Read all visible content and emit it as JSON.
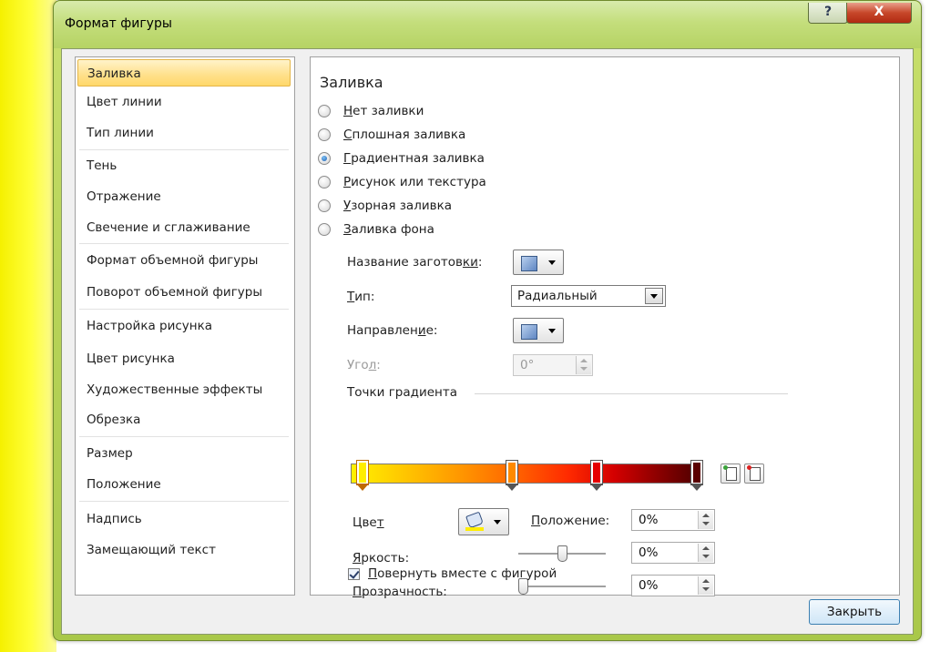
{
  "window": {
    "title": "Формат фигуры",
    "help_symbol": "?",
    "close_symbol": "X"
  },
  "nav": {
    "items": [
      {
        "label": "Заливка",
        "selected": true
      },
      {
        "label": "Цвет линии"
      },
      {
        "label": "Тип линии"
      },
      {
        "label": "Тень"
      },
      {
        "label": "Отражение"
      },
      {
        "label": "Свечение и сглаживание"
      },
      {
        "label": "Формат объемной фигуры"
      },
      {
        "label": "Поворот объемной фигуры"
      },
      {
        "label": "Настройка рисунка"
      },
      {
        "label": "Цвет рисунка"
      },
      {
        "label": "Художественные эффекты"
      },
      {
        "label": "Обрезка"
      },
      {
        "label": "Размер"
      },
      {
        "label": "Положение"
      },
      {
        "label": "Надпись"
      },
      {
        "label": "Замещающий текст"
      }
    ]
  },
  "fill": {
    "heading": "Заливка",
    "options": [
      {
        "hot": "Н",
        "rest": "ет заливки",
        "checked": false
      },
      {
        "hot": "С",
        "rest": "плошная заливка",
        "checked": false
      },
      {
        "hot": "Г",
        "rest": "радиентная заливка",
        "checked": true
      },
      {
        "hot": "Р",
        "rest": "исунок или текстура",
        "checked": false
      },
      {
        "hot": "У",
        "rest": "зорная заливка",
        "checked": false
      },
      {
        "hot": "З",
        "rest": "аливка фона",
        "checked": false
      }
    ],
    "preset_label_a": "Название заготов",
    "preset_label_hot": "ки",
    "preset_label_b": ":",
    "type_label_hot": "Т",
    "type_label_rest": "ип:",
    "type_value": "Радиальный",
    "direction_label_a": "Направлен",
    "direction_label_hot": "и",
    "direction_label_b": "е:",
    "angle_label_a": "Уго",
    "angle_label_hot": "л",
    "angle_label_b": ":",
    "angle_value": "0°",
    "stops_heading": "Точки градиента",
    "color_label_a": "Цве",
    "color_label_hot": "т",
    "position_label_hot": "П",
    "position_label_rest": "оложение:",
    "position_value": "0%",
    "brightness_label_hot": "Я",
    "brightness_label_rest": "ркость:",
    "brightness_value": "0%",
    "transparency_label_hot": "П",
    "transparency_label_rest": "розрачность:",
    "transparency_value": "0%",
    "rotate_label_hot": "П",
    "rotate_label_rest": "овернуть вместе с фигурой",
    "rotate_checked": true,
    "brightness_level_pct": 50,
    "transparency_level_pct": 0
  },
  "gradient_stops": [
    {
      "color": "#ffee00",
      "selected": true
    },
    {
      "color": "#ff8a00"
    },
    {
      "color": "#e60000"
    },
    {
      "color": "#5a0000"
    }
  ],
  "footer": {
    "close_label": "Закрыть"
  }
}
